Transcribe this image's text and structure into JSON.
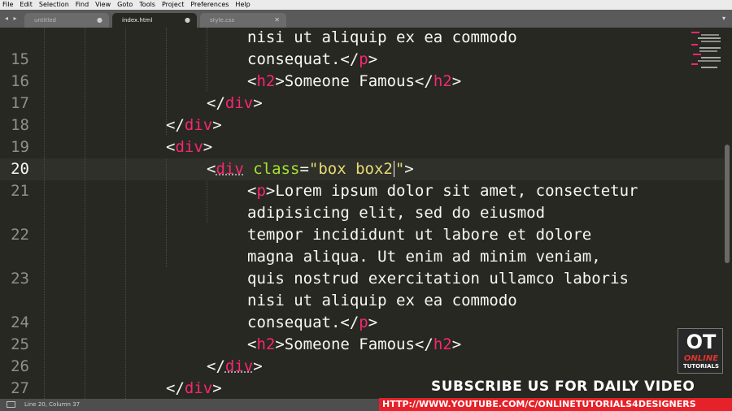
{
  "menu": [
    "File",
    "Edit",
    "Selection",
    "Find",
    "View",
    "Goto",
    "Tools",
    "Project",
    "Preferences",
    "Help"
  ],
  "tabs": [
    {
      "label": "untitled",
      "state": "inactive"
    },
    {
      "label": "index.html",
      "state": "active"
    },
    {
      "label": "style.css",
      "state": "inactive"
    }
  ],
  "tab_nav": "◂ ▸",
  "tab_menu_icon": "▾",
  "editor": {
    "active_line": "20",
    "lines": [
      {
        "no": "",
        "segs": [
          [
            "txt",
            "nisi ut aliquip ex ea commodo"
          ]
        ]
      },
      {
        "no": "15",
        "segs": [
          [
            "txt",
            "consequat."
          ],
          [
            "txt",
            "</"
          ],
          [
            "tag",
            "p"
          ],
          [
            "txt",
            ">"
          ]
        ]
      },
      {
        "no": "16",
        "segs": [
          [
            "txt",
            "<"
          ],
          [
            "tag",
            "h2"
          ],
          [
            "txt",
            ">Someone Famous</"
          ],
          [
            "tag",
            "h2"
          ],
          [
            "txt",
            ">"
          ]
        ]
      },
      {
        "no": "17",
        "segs": [
          [
            "txt",
            "</"
          ],
          [
            "tag",
            "div"
          ],
          [
            "txt",
            ">"
          ]
        ]
      },
      {
        "no": "18",
        "segs": [
          [
            "txt",
            "</"
          ],
          [
            "tag",
            "div"
          ],
          [
            "txt",
            ">"
          ]
        ]
      },
      {
        "no": "19",
        "segs": [
          [
            "txt",
            "<"
          ],
          [
            "tag",
            "div"
          ],
          [
            "txt",
            ">"
          ]
        ]
      },
      {
        "no": "20",
        "segs": [
          [
            "txt",
            "<"
          ],
          [
            "tag-ul",
            "div"
          ],
          [
            "txt",
            " "
          ],
          [
            "attr",
            "class"
          ],
          [
            "txt",
            "="
          ],
          [
            "str",
            "\"box box2"
          ],
          [
            "caret",
            ""
          ],
          [
            "str",
            "\""
          ],
          [
            "txt",
            ">"
          ]
        ]
      },
      {
        "no": "21",
        "segs": [
          [
            "txt",
            "<"
          ],
          [
            "tag",
            "p"
          ],
          [
            "txt",
            ">Lorem ipsum dolor sit amet, consectetur"
          ]
        ]
      },
      {
        "no": "",
        "segs": [
          [
            "txt",
            "adipisicing elit, sed do eiusmod"
          ]
        ]
      },
      {
        "no": "22",
        "segs": [
          [
            "txt",
            "tempor incididunt ut labore et dolore"
          ]
        ]
      },
      {
        "no": "",
        "segs": [
          [
            "txt",
            "magna aliqua. Ut enim ad minim veniam,"
          ]
        ]
      },
      {
        "no": "23",
        "segs": [
          [
            "txt",
            "quis nostrud exercitation ullamco laboris"
          ]
        ]
      },
      {
        "no": "",
        "segs": [
          [
            "txt",
            "nisi ut aliquip ex ea commodo"
          ]
        ]
      },
      {
        "no": "24",
        "segs": [
          [
            "txt",
            "consequat."
          ],
          [
            "txt",
            "</"
          ],
          [
            "tag",
            "p"
          ],
          [
            "txt",
            ">"
          ]
        ]
      },
      {
        "no": "25",
        "segs": [
          [
            "txt",
            "<"
          ],
          [
            "tag",
            "h2"
          ],
          [
            "txt",
            ">Someone Famous</"
          ],
          [
            "tag",
            "h2"
          ],
          [
            "txt",
            ">"
          ]
        ]
      },
      {
        "no": "26",
        "segs": [
          [
            "txt",
            "</"
          ],
          [
            "tag-ul",
            "div"
          ],
          [
            "txt",
            ">"
          ]
        ]
      },
      {
        "no": "27",
        "segs": [
          [
            "txt",
            "</"
          ],
          [
            "tag",
            "div"
          ],
          [
            "txt",
            ">"
          ]
        ]
      }
    ]
  },
  "status": "Line 20, Column 37",
  "logo": {
    "ot": "OT",
    "online": "ONLINE",
    "tutorials": "TUTORIALS"
  },
  "subscribe_text": "SUBSCRIBE US FOR DAILY VIDEO",
  "channel_url": "HTTP://WWW.YOUTUBE.COM/C/ONLINETUTORIALS4DESIGNERS",
  "colors": {
    "tag": "#f92672",
    "attribute": "#a6e22e",
    "string": "#e6db74",
    "text": "#f8f8f2",
    "banner": "#e52229"
  }
}
